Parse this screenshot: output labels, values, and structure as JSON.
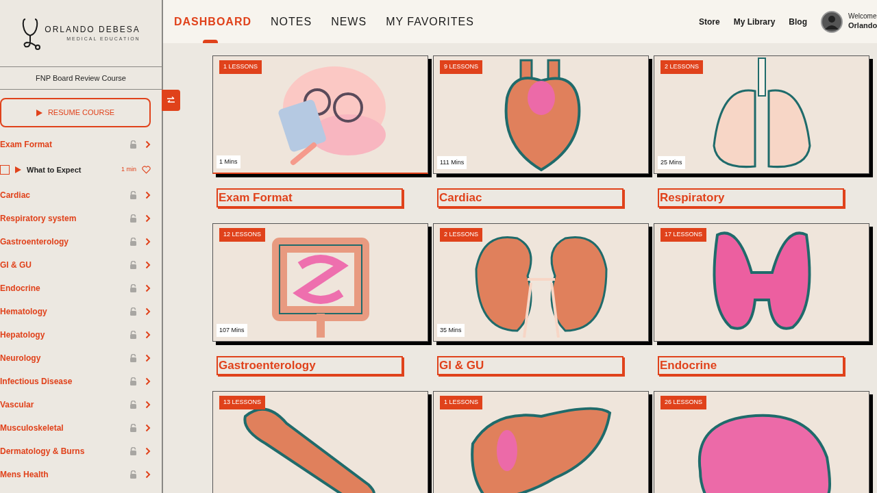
{
  "brand": {
    "name": "ORLANDO DEBESA",
    "tagline": "MEDICAL EDUCATION"
  },
  "course_title": "FNP Board Review Course",
  "resume_button": "RESUME COURSE",
  "sidebar": {
    "items": [
      {
        "label": "Exam Format",
        "children": [
          {
            "label": "What to Expect",
            "duration": "1 min",
            "checked": false
          }
        ]
      },
      {
        "label": "Cardiac"
      },
      {
        "label": "Respiratory system"
      },
      {
        "label": "Gastroenterology"
      },
      {
        "label": "GI & GU"
      },
      {
        "label": "Endocrine"
      },
      {
        "label": "Hematology"
      },
      {
        "label": "Hepatology"
      },
      {
        "label": "Neurology"
      },
      {
        "label": "Infectious Disease"
      },
      {
        "label": "Vascular"
      },
      {
        "label": "Musculoskeletal"
      },
      {
        "label": "Dermatology & Burns"
      },
      {
        "label": "Mens Health"
      }
    ]
  },
  "tabs": [
    {
      "label": "DASHBOARD",
      "selected": true
    },
    {
      "label": "NOTES",
      "selected": false
    },
    {
      "label": "NEWS",
      "selected": false
    },
    {
      "label": "MY FAVORITES",
      "selected": false
    }
  ],
  "top_links": [
    "Store",
    "My Library",
    "Blog"
  ],
  "user": {
    "greeting": "Welcome",
    "name": "Orlando"
  },
  "cards": [
    {
      "kind": "brain-reading",
      "lessons": "1 LESSONS",
      "duration": "1 Mins",
      "title": "Exam Format",
      "selected": true
    },
    {
      "kind": "heart",
      "lessons": "9 LESSONS",
      "duration": "111 Mins",
      "title": "Cardiac",
      "selected": false
    },
    {
      "kind": "lungs",
      "lessons": "2 LESSONS",
      "duration": "25 Mins",
      "title": "Respiratory",
      "selected": false
    },
    {
      "kind": "intestine",
      "lessons": "12 LESSONS",
      "duration": "107 Mins",
      "title": "Gastroenterology",
      "selected": false
    },
    {
      "kind": "kidneys",
      "lessons": "2 LESSONS",
      "duration": "35 Mins",
      "title": "GI & GU",
      "selected": false
    },
    {
      "kind": "thyroid",
      "lessons": "17 LESSONS",
      "title": "Endocrine",
      "selected": false
    },
    {
      "kind": "pancreas",
      "lessons": "13 LESSONS",
      "selected": false
    },
    {
      "kind": "liver",
      "lessons": "1 LESSONS",
      "selected": false
    },
    {
      "kind": "brain",
      "lessons": "26 LESSONS",
      "selected": false
    }
  ]
}
